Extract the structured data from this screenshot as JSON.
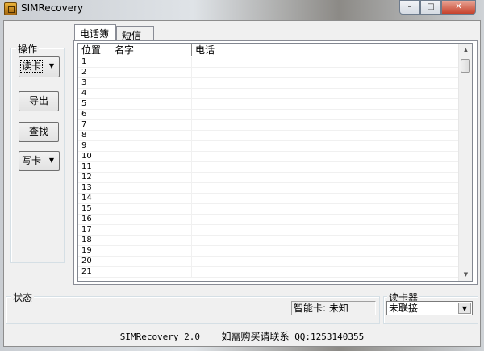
{
  "window": {
    "title": "SIMRecovery",
    "min": "–",
    "max": "□",
    "close": "✕"
  },
  "ops": {
    "label": "操作",
    "read_card": "读卡",
    "export": "导出",
    "find": "查找",
    "write_card": "写卡",
    "dropdown": "▼"
  },
  "tabs": [
    {
      "label": "电话簿"
    },
    {
      "label": "短信"
    }
  ],
  "table": {
    "columns": [
      "位置",
      "名字",
      "电话",
      ""
    ],
    "rows": [
      "1",
      "2",
      "3",
      "4",
      "5",
      "6",
      "7",
      "8",
      "9",
      "10",
      "11",
      "12",
      "13",
      "14",
      "15",
      "16",
      "17",
      "18",
      "19",
      "20",
      "21"
    ]
  },
  "scroll": {
    "up": "▲",
    "down": "▼"
  },
  "status": {
    "label": "状态",
    "smartcard": "智能卡: 未知"
  },
  "reader": {
    "label": "读卡器",
    "value": "未联接",
    "arrow": "▼"
  },
  "footer": {
    "version": "SIMRecovery 2.0",
    "contact": "如需购买请联系",
    "qq": "QQ:1253140355"
  }
}
